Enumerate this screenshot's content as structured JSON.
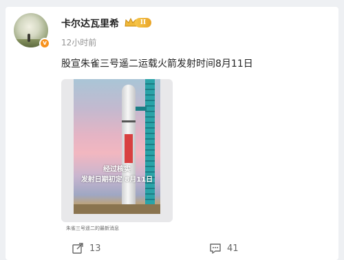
{
  "post": {
    "author": {
      "name": "卡尔达瓦里希",
      "vip_level": "II",
      "avatar_icon": "avatar-image",
      "verified_icon": "verified-badge-icon"
    },
    "time": "12小时前",
    "text": "股宣朱雀三号遥二运载火箭发射时间8月11日",
    "media": {
      "overlay_line1": "经过核实",
      "overlay_line2": "发射日期初定 8月11日",
      "caption": "朱雀三号遥二的最新消息",
      "dots": 2,
      "active_dot": 0
    },
    "actions": {
      "repost_count": "13",
      "comment_count": "41"
    }
  },
  "colors": {
    "background": "#eef0f3",
    "card": "#ffffff",
    "text": "#222222",
    "muted": "#939393",
    "verified": "#f7921e",
    "vip_gold": "#f6c64a"
  }
}
